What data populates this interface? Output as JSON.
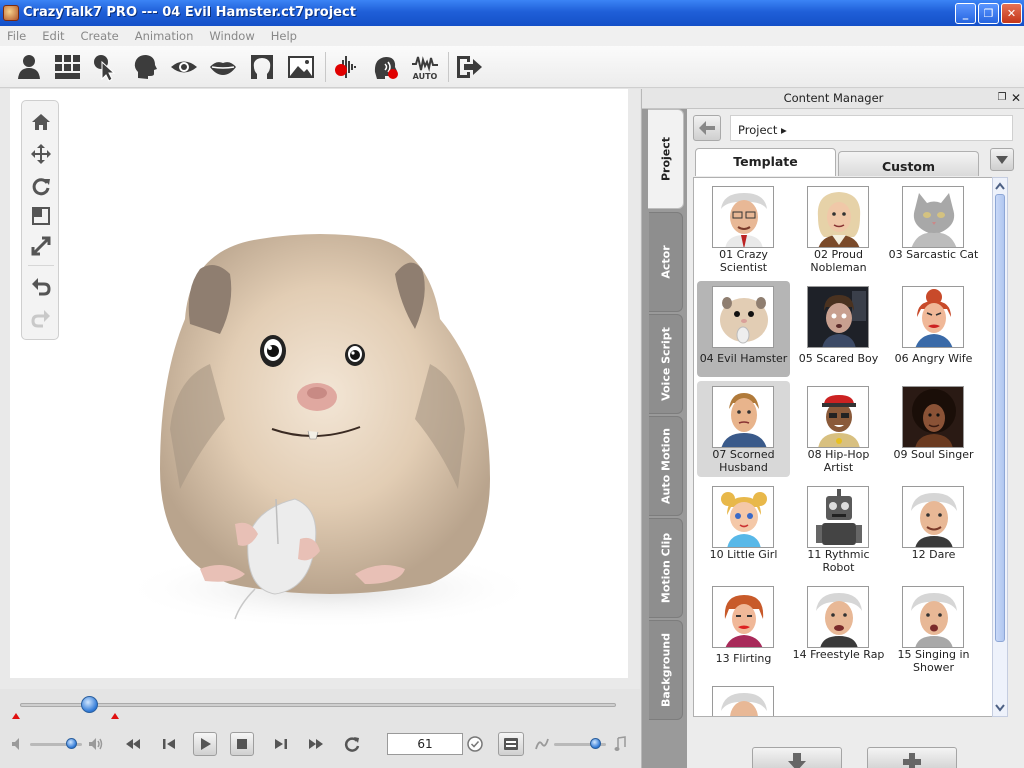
{
  "window": {
    "title": "CrazyTalk7 PRO --- 04 Evil Hamster.ct7project",
    "controls": {
      "minimize": "_",
      "restore": "❐",
      "close": "✕"
    }
  },
  "menu": [
    "File",
    "Edit",
    "Create",
    "Animation",
    "Window",
    "Help"
  ],
  "toolbar": {
    "icons": [
      "actor-icon",
      "grid-icon",
      "pointer-icon",
      "head-icon",
      "eye-icon",
      "mouth-icon",
      "face-outline-icon",
      "image-icon",
      "record-icon",
      "record-voice-icon",
      "auto-icon",
      "exit-icon"
    ],
    "auto_label": "AUTO",
    "colors": {
      "icon": "#3c3c3c",
      "record": "#e00000"
    }
  },
  "viewtools": [
    "home-icon",
    "move-icon",
    "rotate-icon",
    "scale-icon",
    "zoom-icon",
    "undo-icon",
    "redo-icon"
  ],
  "playback": {
    "frame": "61",
    "timeline_position": 0.115,
    "volume_level": 0.8,
    "speed_level": 0.8
  },
  "content_manager": {
    "title": "Content Manager",
    "side_tabs": [
      "Project",
      "Actor",
      "Voice Script",
      "Auto Motion",
      "Motion Clip",
      "Background"
    ],
    "active_side_tab": "Project",
    "path": "Project ▸",
    "tabs": [
      "Template",
      "Custom"
    ],
    "active_tab": "Template",
    "items": [
      {
        "label": "01 Crazy Scientist"
      },
      {
        "label": "02 Proud Nobleman"
      },
      {
        "label": "03 Sarcastic Cat"
      },
      {
        "label": "04 Evil Hamster",
        "state": "selected"
      },
      {
        "label": "05 Scared Boy"
      },
      {
        "label": "06 Angry Wife"
      },
      {
        "label": "07 Scorned Husband",
        "state": "hover"
      },
      {
        "label": "08 Hip-Hop Artist"
      },
      {
        "label": "09 Soul Singer"
      },
      {
        "label": "10 Little Girl"
      },
      {
        "label": "11 Rythmic Robot"
      },
      {
        "label": "12 Dare"
      },
      {
        "label": "13 Flirting"
      },
      {
        "label": "14 Freestyle Rap"
      },
      {
        "label": "15 Singing in Shower"
      },
      {
        "label": ""
      }
    ]
  }
}
